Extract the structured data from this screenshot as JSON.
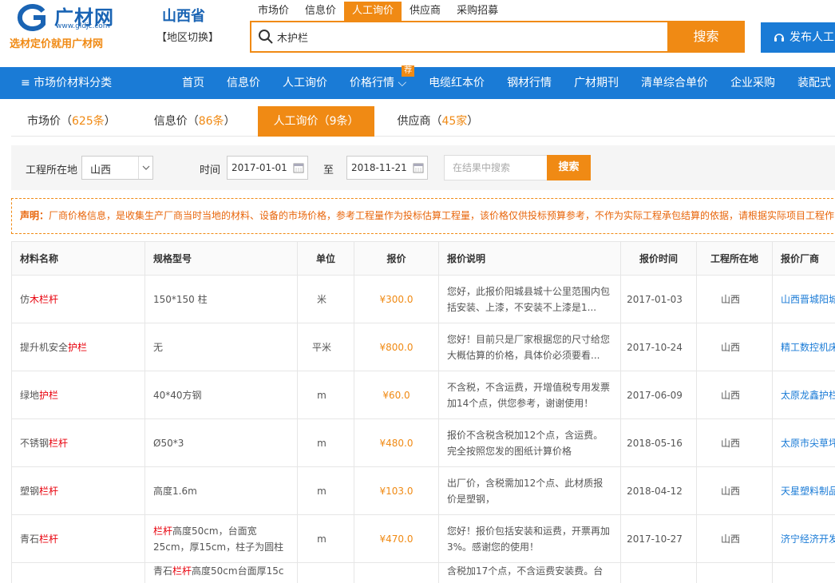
{
  "header": {
    "logo_name": "广材网",
    "logo_url": "www.gldjc.com",
    "slogan": "选材定价就用广材网",
    "region": "山西省",
    "region_switch": "【地区切换】",
    "search_tabs": [
      "市场价",
      "信息价",
      "人工询价",
      "供应商",
      "采购招募"
    ],
    "search_value": "木护栏",
    "search_button": "搜索",
    "publish_button": "发布人工"
  },
  "nav": {
    "category": "≡ 市场价材料分类",
    "items": [
      "首页",
      "信息价",
      "人工询价",
      "价格行情 ⌵",
      "电缆红本价",
      "钢材行情",
      "广材期刊",
      "清单综合单价",
      "企业采购",
      "装配式"
    ],
    "badge": "荐"
  },
  "result_tabs": [
    {
      "label": "市场价（",
      "count": "625条",
      "close": "）"
    },
    {
      "label": "信息价（",
      "count": "86条",
      "close": "）"
    },
    {
      "label": "人工询价（",
      "count": "9条",
      "close": "）"
    },
    {
      "label": "供应商（",
      "count": "45家",
      "close": "）"
    }
  ],
  "filter": {
    "location_label": "工程所在地",
    "location_value": "山西",
    "time_label": "时间",
    "date_from": "2017-01-01",
    "to_label": "至",
    "date_to": "2018-11-21",
    "search_placeholder": "在结果中搜索",
    "search_button": "搜索"
  },
  "notice": {
    "title": "声明：",
    "text": "厂商价格信息，是收集生产厂商当时当地的材料、设备的市场价格，参考工程量作为投标估算工程量，该价格仅供投标预算参考，不作为实际工程承包结算的依据，请根据实际项目工程作"
  },
  "table": {
    "headers": [
      "材料名称",
      "规格型号",
      "单位",
      "报价",
      "报价说明",
      "报价时间",
      "工程所在地",
      "报价厂商"
    ],
    "rows": [
      {
        "name_pre": "仿",
        "name_hl": "木栏杆",
        "name_post": "",
        "spec_hl": "",
        "spec": "150*150 柱",
        "unit": "米",
        "price": "¥300.0",
        "desc": "您好，此报价阳城县城十公里范围内包括安装、上漆，不安装不上漆是1...",
        "date": "2017-01-03",
        "loc": "山西",
        "vendor": "山西晋城阳城"
      },
      {
        "name_pre": "提升机安全",
        "name_hl": "护栏",
        "name_post": "",
        "spec_hl": "",
        "spec": "无",
        "unit": "平米",
        "price": "¥800.0",
        "desc": "您好！目前只是厂家根据您的尺寸给您大概估算的价格，具体价必须要看...",
        "date": "2017-10-24",
        "loc": "山西",
        "vendor": "精工数控机床"
      },
      {
        "name_pre": "绿地",
        "name_hl": "护栏",
        "name_post": "",
        "spec_hl": "",
        "spec": "40*40方钢",
        "unit": "m",
        "price": "¥60.0",
        "desc": "不含税，不含运费，开增值税专用发票加14个点，供您参考，谢谢使用！",
        "date": "2017-06-09",
        "loc": "山西",
        "vendor": "太原龙鑫护栏"
      },
      {
        "name_pre": "不锈钢",
        "name_hl": "栏杆",
        "name_post": "",
        "spec_hl": "",
        "spec": "Ø50*3",
        "unit": "m",
        "price": "¥480.0",
        "desc": "报价不含税含税加12个点，含运费。完全按照您发的图纸计算价格",
        "date": "2018-05-16",
        "loc": "山西",
        "vendor": "太原市尖草坪"
      },
      {
        "name_pre": "塑钢",
        "name_hl": "栏杆",
        "name_post": "",
        "spec_hl": "",
        "spec": "高度1.6m",
        "unit": "m",
        "price": "¥103.0",
        "desc": "出厂价，含税需加12个点、此材质报价是塑钢，",
        "date": "2018-04-12",
        "loc": "山西",
        "vendor": "天星塑料制品"
      },
      {
        "name_pre": "青石",
        "name_hl": "栏杆",
        "name_post": "",
        "spec_hl": "栏杆",
        "spec": "高度50cm，台面宽25cm，厚15cm，柱子为圆柱形...",
        "unit": "m",
        "price": "¥470.0",
        "desc": "您好！报价包括安装和运费，开票再加3%。感谢您的使用！",
        "date": "2017-10-27",
        "loc": "山西",
        "vendor": "济宁经济开发"
      },
      {
        "name_pre": "",
        "name_hl": "",
        "name_post": "",
        "spec_hl": "栏杆",
        "spec_pre": "青石",
        "spec": "高度50cm台面厚15c",
        "unit": "",
        "price": "",
        "desc": "含税加17个点，不含运费安装费。台",
        "date": "",
        "loc": "",
        "vendor": ""
      }
    ]
  },
  "colors": {
    "accent": "#f08a14",
    "brand": "#1a7bd6",
    "highlight": "#e8000b"
  }
}
